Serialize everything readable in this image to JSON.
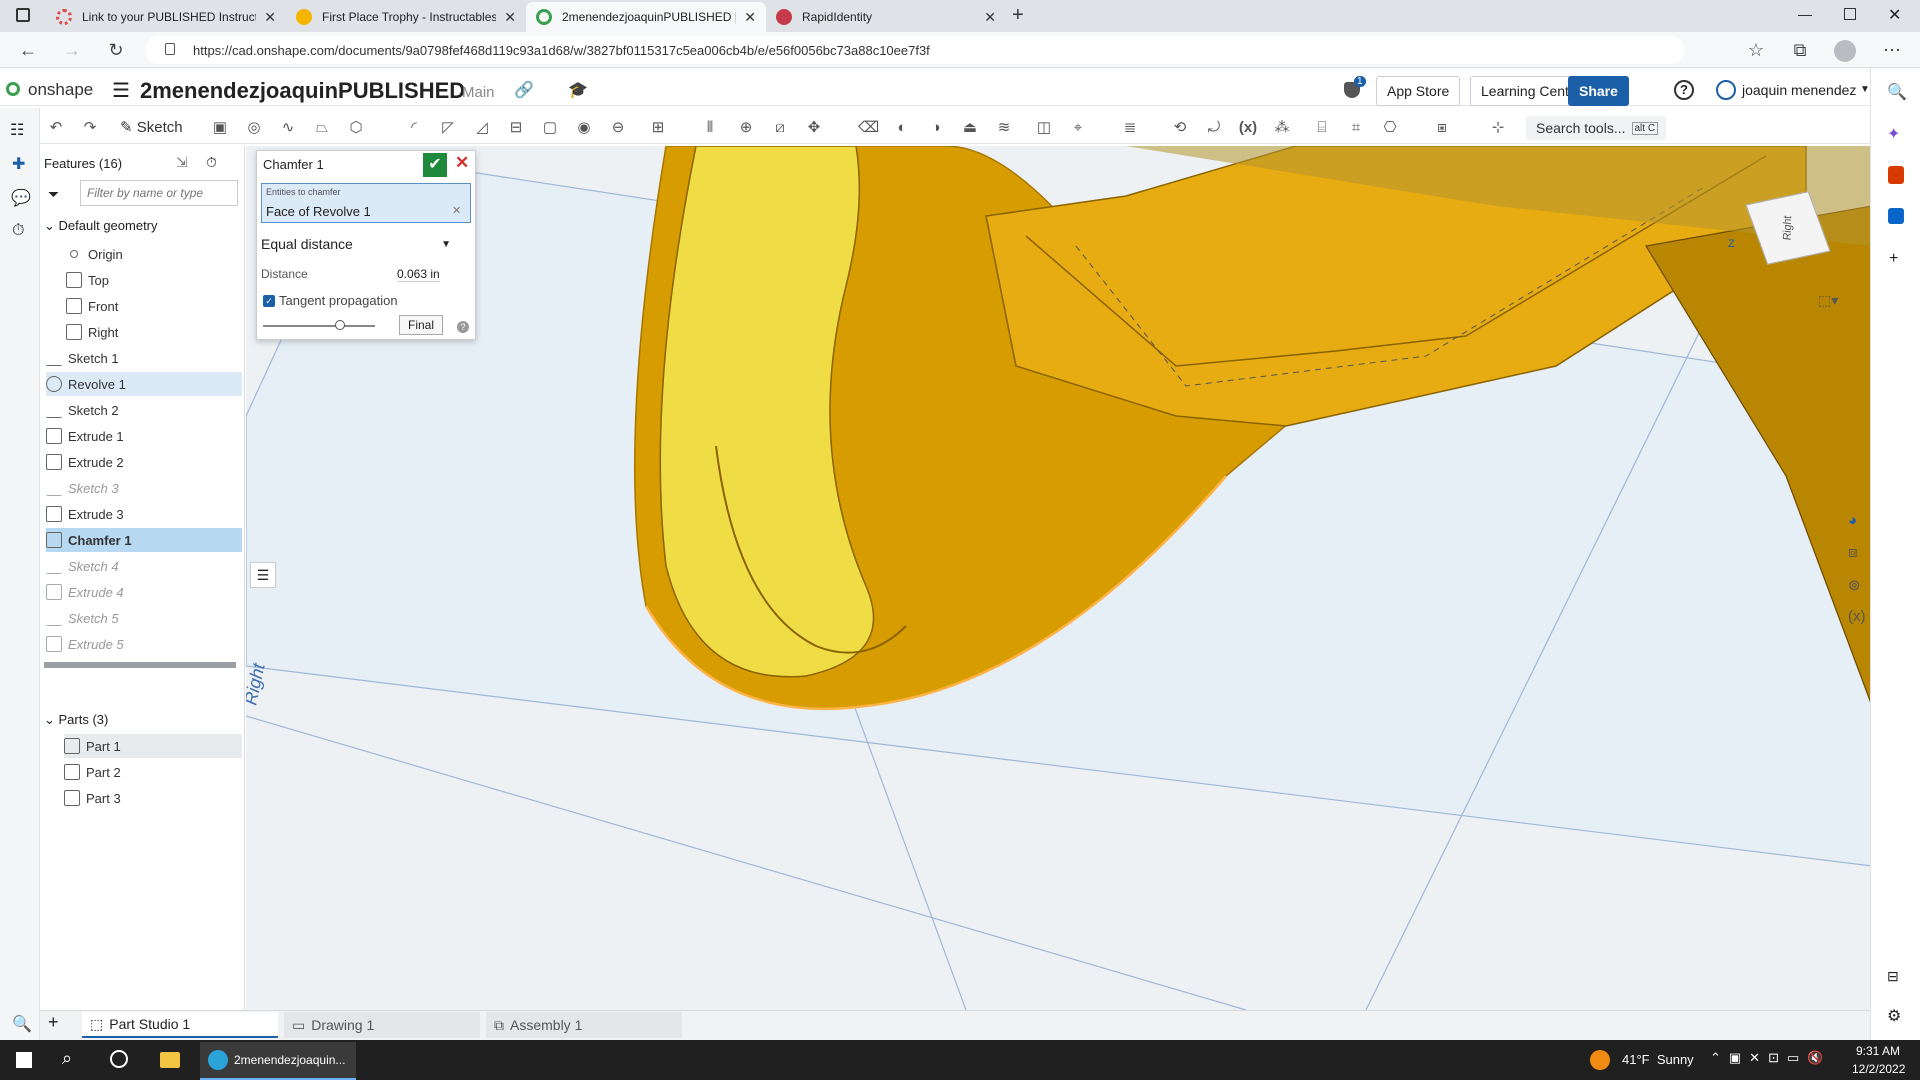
{
  "browser": {
    "tabs": [
      {
        "title": "Link to your PUBLISHED Instructa",
        "active": false,
        "color": "#e04c4c"
      },
      {
        "title": "First Place Trophy - Instructables",
        "active": false,
        "color": "#f4b400"
      },
      {
        "title": "2menendezjoaquinPUBLISHED |",
        "active": true,
        "color": "#3a9f4f"
      },
      {
        "title": "RapidIdentity",
        "active": false,
        "color": "#c43b4a"
      }
    ],
    "url": "https://cad.onshape.com/documents/9a0798fef468d119c93a1d68/w/3827bf0115317c5ea006cb4b/e/e56f0056bc73a88c10ee7f3f"
  },
  "onshape": {
    "logo": "onshape",
    "doc_title": "2menendezjoaquinPUBLISHED",
    "branch": "Main",
    "notif_count": "1",
    "app_store": "App Store",
    "learning": "Learning Center",
    "share": "Share",
    "user": "joaquin menendez",
    "sketch_label": "Sketch",
    "search_tools": "Search tools...",
    "search_shortcut": "alt C"
  },
  "features": {
    "header": "Features (16)",
    "filter_placeholder": "Filter by name or type",
    "default_geometry": "Default geometry",
    "items": [
      {
        "label": "Origin",
        "state": "normal"
      },
      {
        "label": "Top",
        "state": "normal"
      },
      {
        "label": "Front",
        "state": "normal"
      },
      {
        "label": "Right",
        "state": "normal"
      },
      {
        "label": "Sketch 1",
        "state": "normal"
      },
      {
        "label": "Revolve 1",
        "state": "highlight"
      },
      {
        "label": "Sketch 2",
        "state": "normal"
      },
      {
        "label": "Extrude 1",
        "state": "normal"
      },
      {
        "label": "Extrude 2",
        "state": "normal"
      },
      {
        "label": "Sketch 3",
        "state": "dim"
      },
      {
        "label": "Extrude 3",
        "state": "normal"
      },
      {
        "label": "Chamfer 1",
        "state": "selected"
      },
      {
        "label": "Sketch 4",
        "state": "dim"
      },
      {
        "label": "Extrude 4",
        "state": "dim"
      },
      {
        "label": "Sketch 5",
        "state": "dim"
      },
      {
        "label": "Extrude 5",
        "state": "dim"
      }
    ],
    "parts_header": "Parts (3)",
    "parts": [
      "Part 1",
      "Part 2",
      "Part 3"
    ]
  },
  "chamfer": {
    "title": "Chamfer 1",
    "entities_label": "Entities to chamfer",
    "entity_value": "Face of Revolve 1",
    "type": "Equal distance",
    "distance_label": "Distance",
    "distance_value": "0.063 in",
    "tangent_label": "Tangent propagation",
    "final_label": "Final"
  },
  "viewport": {
    "plane_label": "Right",
    "cube_label": "Right"
  },
  "bottom_tabs": [
    {
      "label": "Part Studio 1",
      "active": true
    },
    {
      "label": "Drawing 1",
      "active": false
    },
    {
      "label": "Assembly 1",
      "active": false
    }
  ],
  "taskbar": {
    "app_label": "2menendezjoaquin...",
    "weather": "41°F  Sunny",
    "time": "9:31 AM",
    "date": "12/2/2022"
  },
  "colors": {
    "accent": "#1b5fa8",
    "gold": "#e0a400",
    "confirm": "#1f8a3b",
    "cancel": "#d32f2f"
  }
}
